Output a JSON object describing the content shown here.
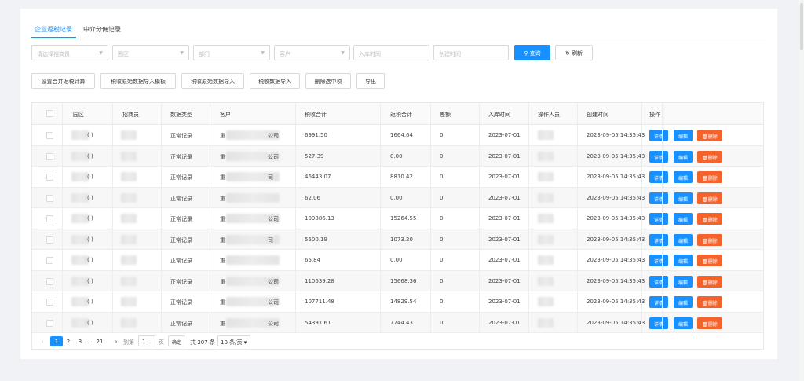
{
  "tabs": [
    {
      "label": "企业返税记录",
      "active": true
    },
    {
      "label": "中介分佣记录",
      "active": false
    }
  ],
  "filters": {
    "merchant_placeholder": "请选择招商员",
    "park_placeholder": "园区",
    "dept_placeholder": "部门",
    "customer_placeholder": "客户",
    "storage_time_placeholder": "入库时间",
    "create_time_placeholder": "创建时间",
    "query_label": "查询",
    "refresh_label": "刷新"
  },
  "actions": [
    "设置合并返税计算",
    "税收原始数据导入模板",
    "税收原始数据导入",
    "税收数据导入",
    "删除选中项",
    "导出"
  ],
  "table": {
    "columns": [
      "园区",
      "招商员",
      "数据类型",
      "客户",
      "税收合计",
      "返税合计",
      "差额",
      "入库时间",
      "操作人员",
      "创建时间",
      "操作"
    ],
    "rows": [
      {
        "park": "(  )",
        "type": "正常记录",
        "customer_a": "重",
        "customer_b": "公司",
        "tax_total": "6991.50",
        "refund_total": "1664.64",
        "diff": "0",
        "storage_time": "2023-07-01",
        "created": "2023-09-05 14:35:43"
      },
      {
        "park": "(  )",
        "type": "正常记录",
        "customer_a": "重",
        "customer_b": "公司",
        "tax_total": "527.39",
        "refund_total": "0.00",
        "diff": "0",
        "storage_time": "2023-07-01",
        "created": "2023-09-05 14:35:43"
      },
      {
        "park": "(  )",
        "type": "正常记录",
        "customer_a": "重",
        "customer_b": "司",
        "tax_total": "46443.07",
        "refund_total": "8810.42",
        "diff": "0",
        "storage_time": "2023-07-01",
        "created": "2023-09-05 14:35:43"
      },
      {
        "park": "(  )",
        "type": "正常记录",
        "customer_a": "重",
        "customer_b": "",
        "tax_total": "62.06",
        "refund_total": "0.00",
        "diff": "0",
        "storage_time": "2023-07-01",
        "created": "2023-09-05 14:35:43"
      },
      {
        "park": "(  )",
        "type": "正常记录",
        "customer_a": "重",
        "customer_b": "公司",
        "tax_total": "109886.13",
        "refund_total": "15264.55",
        "diff": "0",
        "storage_time": "2023-07-01",
        "created": "2023-09-05 14:35:43"
      },
      {
        "park": "(  )",
        "type": "正常记录",
        "customer_a": "重",
        "customer_b": "司",
        "tax_total": "5500.19",
        "refund_total": "1073.20",
        "diff": "0",
        "storage_time": "2023-07-01",
        "created": "2023-09-05 14:35:43"
      },
      {
        "park": "(  )",
        "type": "正常记录",
        "customer_a": "重",
        "customer_b": "",
        "tax_total": "65.84",
        "refund_total": "0.00",
        "diff": "0",
        "storage_time": "2023-07-01",
        "created": "2023-09-05 14:35:43"
      },
      {
        "park": "(  )",
        "type": "正常记录",
        "customer_a": "重",
        "customer_b": "公司",
        "tax_total": "110639.28",
        "refund_total": "15668.36",
        "diff": "0",
        "storage_time": "2023-07-01",
        "created": "2023-09-05 14:35:43"
      },
      {
        "park": "(  )",
        "type": "正常记录",
        "customer_a": "重",
        "customer_b": "公司",
        "tax_total": "107711.48",
        "refund_total": "14829.54",
        "diff": "0",
        "storage_time": "2023-07-01",
        "created": "2023-09-05 14:35:43"
      },
      {
        "park": "(  )",
        "type": "正常记录",
        "customer_a": "重",
        "customer_b": "公司",
        "tax_total": "54397.61",
        "refund_total": "7744.43",
        "diff": "0",
        "storage_time": "2023-07-01",
        "created": "2023-09-05 14:35:43"
      }
    ],
    "row_actions": {
      "detail": "详情",
      "edit": "编辑",
      "delete": "删除"
    }
  },
  "pagination": {
    "pages": [
      "1",
      "2",
      "3",
      "...",
      "21"
    ],
    "current": "1",
    "goto_label": "到第",
    "goto_value": "1",
    "page_unit": "页",
    "confirm_label": "确定",
    "total_label": "共 207 条",
    "page_size_label": "10 条/页"
  },
  "colors": {
    "primary": "#1890ff",
    "danger": "#f5632c"
  }
}
